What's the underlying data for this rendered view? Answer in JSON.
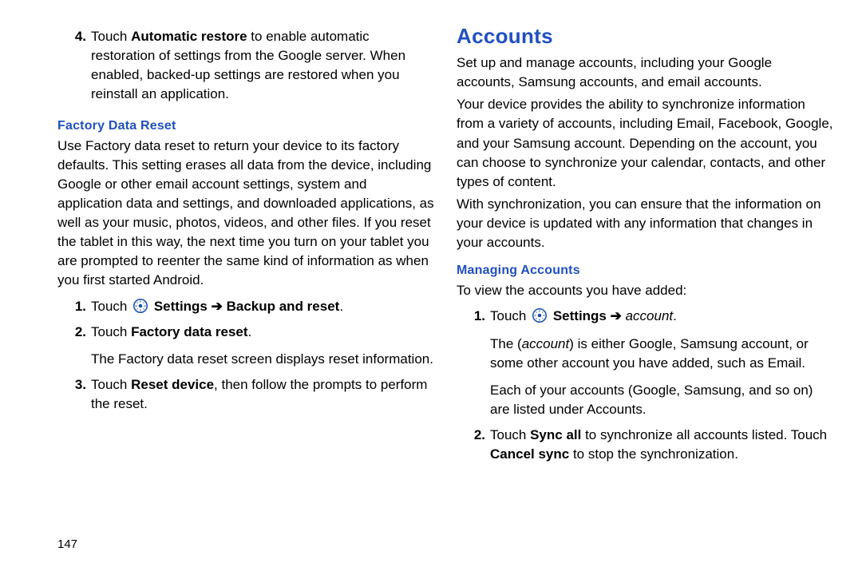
{
  "pageNumber": "147",
  "left": {
    "item4": {
      "num": "4.",
      "pre": "Touch ",
      "bold": "Automatic restore",
      "post": " to enable automatic restoration of settings from the Google server. When enabled, backed-up settings are restored when you reinstall an application."
    },
    "factoryHeading": "Factory Data Reset",
    "factoryPara": "Use Factory data reset to return your device to its factory defaults. This setting erases all data from the device, including Google or other email account settings, system and application data and settings, and downloaded applications, as well as your music, photos, videos, and other files. If you reset the tablet in this way, the next time you turn on your tablet you are prompted to reenter the same kind of information as when you first started Android.",
    "s1": {
      "num": "1.",
      "pre": "Touch ",
      "bold1": "Settings",
      "arrow": " ➔ ",
      "bold2": "Backup and reset",
      "post": "."
    },
    "s2": {
      "num": "2.",
      "pre": "Touch ",
      "bold": "Factory data reset",
      "post": ".",
      "extra": "The Factory data reset screen displays reset information."
    },
    "s3": {
      "num": "3.",
      "pre": "Touch ",
      "bold": "Reset device",
      "post": ", then follow the prompts to perform the reset."
    }
  },
  "right": {
    "heading": "Accounts",
    "p1": "Set up and manage accounts, including your Google accounts, Samsung accounts, and email accounts.",
    "p2": "Your device provides the ability to synchronize information from a variety of accounts, including Email, Facebook, Google, and your Samsung account. Depending on the account, you can choose to synchronize your calendar, contacts, and other types of content.",
    "p3": "With synchronization, you can ensure that the information on your device is updated with any information that changes in your accounts.",
    "manageHeading": "Managing Accounts",
    "managePara": "To view the accounts you have added:",
    "m1": {
      "num": "1.",
      "pre": "Touch ",
      "bold": "Settings",
      "arrow": " ➔ ",
      "italic": "account",
      "post": ".",
      "extraPre": "The (",
      "extraItalic": "account",
      "extraPost": ") is either Google, Samsung account, or some other account you have added, such as Email.",
      "extra2": "Each of your accounts (Google, Samsung, and so on) are listed under Accounts."
    },
    "m2": {
      "num": "2.",
      "pre": "Touch ",
      "bold1": "Sync all",
      "mid": " to synchronize all accounts listed. Touch ",
      "bold2": "Cancel sync",
      "post": " to stop the synchronization."
    }
  }
}
